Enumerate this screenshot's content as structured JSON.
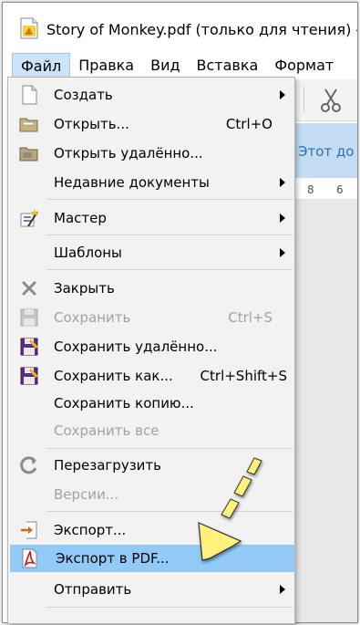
{
  "window": {
    "title": "Story of Monkey.pdf (только для чтения) -"
  },
  "menubar": {
    "items": [
      "Файл",
      "Правка",
      "Вид",
      "Вставка",
      "Формат"
    ]
  },
  "background": {
    "infobar_text": "Этот до",
    "ruler_marks": [
      "8",
      "6"
    ]
  },
  "file_menu": {
    "items": [
      {
        "label": "Создать",
        "shortcut": "",
        "submenu": true,
        "disabled": false,
        "icon": "new-document-icon"
      },
      {
        "label": "Открыть...",
        "shortcut": "Ctrl+O",
        "submenu": false,
        "disabled": false,
        "icon": "open-folder-icon"
      },
      {
        "label": "Открыть удалённо...",
        "shortcut": "",
        "submenu": false,
        "disabled": false,
        "icon": "remote-folder-icon"
      },
      {
        "label": "Недавние документы",
        "shortcut": "",
        "submenu": true,
        "disabled": false,
        "icon": ""
      },
      {
        "label": "Мастер",
        "shortcut": "",
        "submenu": true,
        "disabled": false,
        "icon": "wizard-icon"
      },
      {
        "label": "Шаблоны",
        "shortcut": "",
        "submenu": true,
        "disabled": false,
        "icon": ""
      },
      {
        "label": "Закрыть",
        "shortcut": "",
        "submenu": false,
        "disabled": false,
        "icon": "close-icon"
      },
      {
        "label": "Сохранить",
        "shortcut": "Ctrl+S",
        "submenu": false,
        "disabled": true,
        "icon": "save-icon"
      },
      {
        "label": "Сохранить удалённо...",
        "shortcut": "",
        "submenu": false,
        "disabled": false,
        "icon": "save-remote-icon"
      },
      {
        "label": "Сохранить как...",
        "shortcut": "Ctrl+Shift+S",
        "submenu": false,
        "disabled": false,
        "icon": "save-as-icon"
      },
      {
        "label": "Сохранить копию...",
        "shortcut": "",
        "submenu": false,
        "disabled": false,
        "icon": ""
      },
      {
        "label": "Сохранить все",
        "shortcut": "",
        "submenu": false,
        "disabled": true,
        "icon": ""
      },
      {
        "label": "Перезагрузить",
        "shortcut": "",
        "submenu": false,
        "disabled": false,
        "icon": "reload-icon"
      },
      {
        "label": "Версии...",
        "shortcut": "",
        "submenu": false,
        "disabled": true,
        "icon": ""
      },
      {
        "label": "Экспорт...",
        "shortcut": "",
        "submenu": false,
        "disabled": false,
        "icon": "export-icon"
      },
      {
        "label": "Экспорт в PDF...",
        "shortcut": "",
        "submenu": false,
        "disabled": false,
        "icon": "pdf-icon",
        "highlighted": true
      },
      {
        "label": "Отправить",
        "shortcut": "",
        "submenu": true,
        "disabled": false,
        "icon": ""
      }
    ]
  },
  "colors": {
    "highlight": "#91c9f7",
    "menu_bg": "#f2f2f2",
    "annotation_arrow": "#fff27a"
  }
}
